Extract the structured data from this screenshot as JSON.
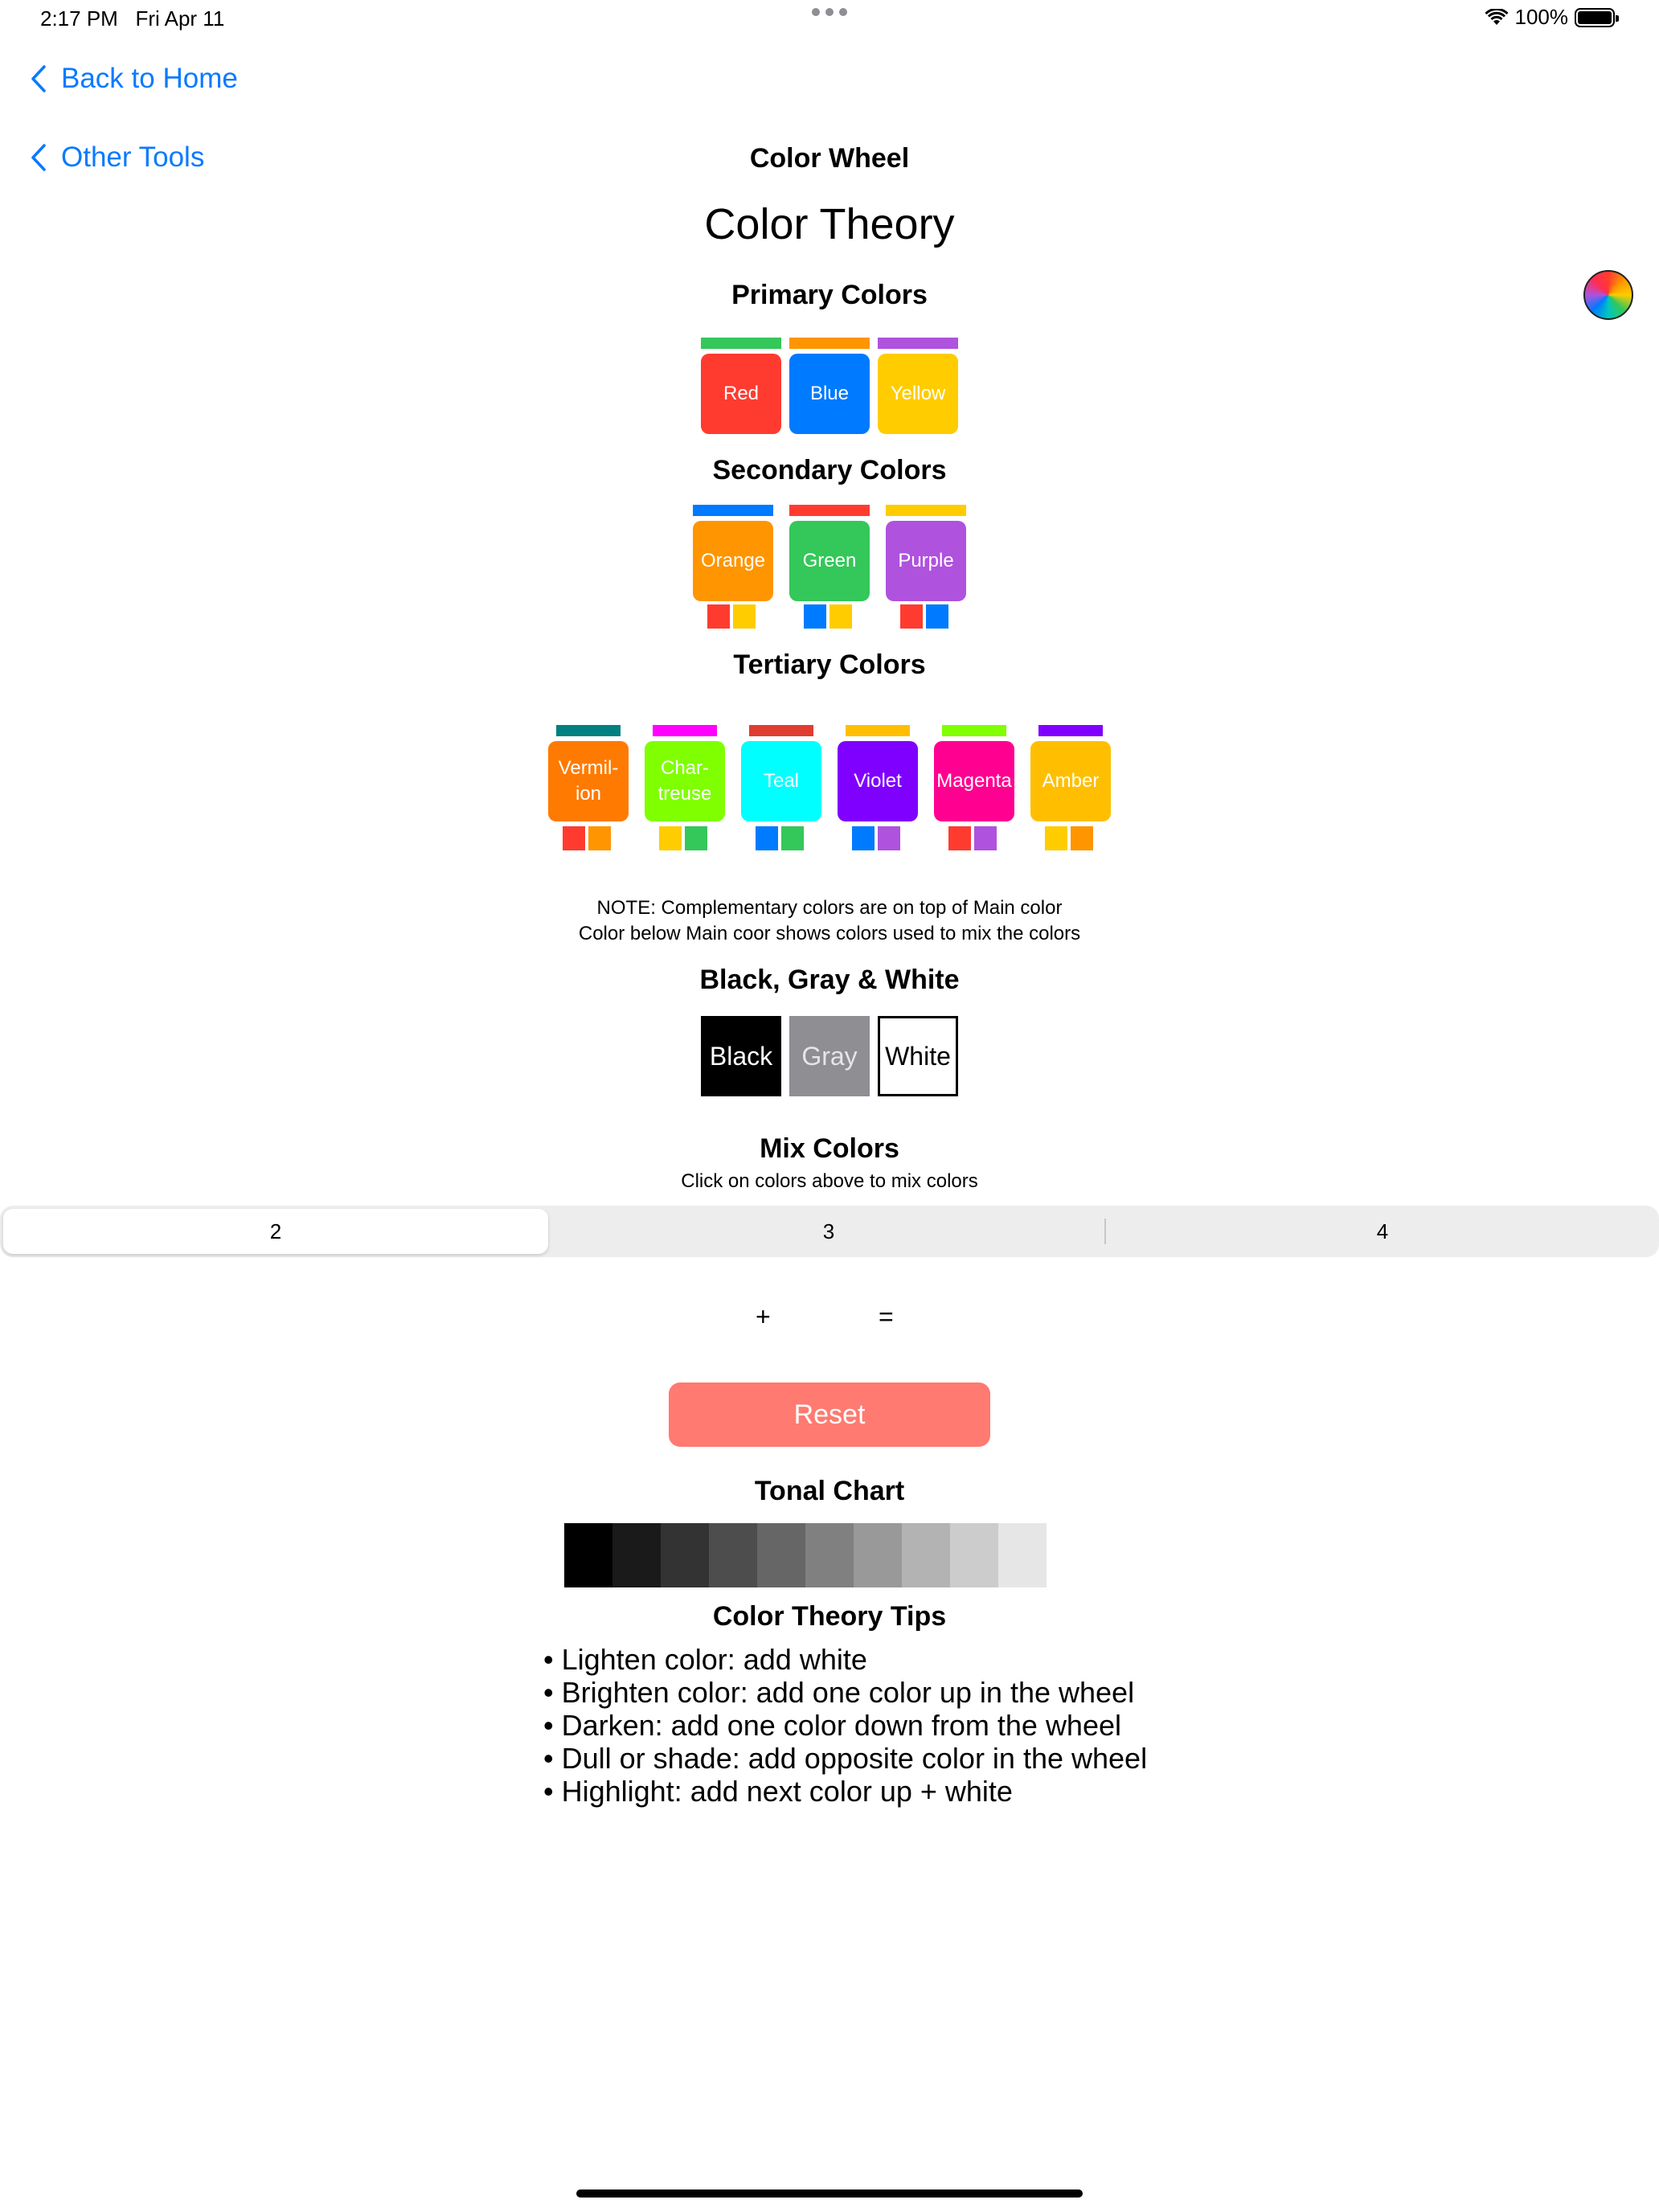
{
  "status_bar": {
    "time": "2:17 PM",
    "date": "Fri Apr 11",
    "battery": "100%"
  },
  "nav": {
    "back_home": "Back to Home",
    "other_tools": "Other Tools",
    "nav_title": "Color Wheel"
  },
  "page_title": "Color Theory",
  "primary": {
    "title": "Primary Colors",
    "items": [
      {
        "label": "Red",
        "color": "#ff3b30",
        "complement": "#34c759"
      },
      {
        "label": "Blue",
        "color": "#007aff",
        "complement": "#ff9500"
      },
      {
        "label": "Yellow",
        "color": "#ffcc00",
        "complement": "#af52de"
      }
    ]
  },
  "secondary": {
    "title": "Secondary Colors",
    "items": [
      {
        "label": "Orange",
        "color": "#ff9500",
        "complement": "#007aff",
        "mix": [
          "#ff3b30",
          "#ffcc00"
        ]
      },
      {
        "label": "Green",
        "color": "#34c759",
        "complement": "#ff3b30",
        "mix": [
          "#007aff",
          "#ffcc00"
        ]
      },
      {
        "label": "Purple",
        "color": "#af52de",
        "complement": "#ffcc00",
        "mix": [
          "#ff3b30",
          "#007aff"
        ]
      }
    ]
  },
  "tertiary": {
    "title": "Tertiary Colors",
    "items": [
      {
        "line1": "Vermil-",
        "line2": "ion",
        "color": "#ff7a00",
        "complement": "#008080",
        "mix": [
          "#ff3b30",
          "#ff9500"
        ]
      },
      {
        "line1": "Char-",
        "line2": "treuse",
        "color": "#7fff00",
        "complement": "#ff00ff",
        "mix": [
          "#ffcc00",
          "#34c759"
        ]
      },
      {
        "line1": "Teal",
        "line2": "",
        "color": "#00ffff",
        "complement": "#e03c31",
        "mix": [
          "#007aff",
          "#34c759"
        ]
      },
      {
        "line1": "Violet",
        "line2": "",
        "color": "#8000ff",
        "complement": "#ffbf00",
        "mix": [
          "#007aff",
          "#af52de"
        ]
      },
      {
        "line1": "Magenta",
        "line2": "",
        "color": "#ff0090",
        "complement": "#80ff00",
        "mix": [
          "#ff3b30",
          "#af52de"
        ]
      },
      {
        "line1": "Amber",
        "line2": "",
        "color": "#ffbf00",
        "complement": "#8000ff",
        "mix": [
          "#ffcc00",
          "#ff9500"
        ]
      }
    ]
  },
  "note": {
    "line1": "NOTE: Complementary colors are on top of Main color",
    "line2": "Color below Main coor shows colors used to mix the colors"
  },
  "bgw": {
    "title": "Black, Gray & White",
    "items": [
      {
        "label": "Black",
        "color": "#000000"
      },
      {
        "label": "Gray",
        "color": "#8e8e93"
      },
      {
        "label": "White",
        "color": "#ffffff"
      }
    ]
  },
  "mix": {
    "title": "Mix Colors",
    "subtitle": "Click on colors above to mix colors",
    "segments": [
      "2",
      "3",
      "4"
    ],
    "selected_segment": "2",
    "plus": "+",
    "equals": "=",
    "reset_label": "Reset"
  },
  "tonal": {
    "title": "Tonal Chart",
    "shades": [
      "#000000",
      "#1a1a1a",
      "#333333",
      "#4d4d4d",
      "#666666",
      "#808080",
      "#999999",
      "#b3b3b3",
      "#cccccc",
      "#e6e6e6"
    ]
  },
  "tips": {
    "title": "Color Theory Tips",
    "items": [
      "• Lighten color: add white",
      "• Brighten color: add one color up in the wheel",
      "• Darken: add one color down from the wheel",
      "• Dull or shade: add opposite color in the wheel",
      "• Highlight: add next color up + white"
    ]
  },
  "colors": {
    "accent": "#0a7aff",
    "reset": "#ff7a70"
  }
}
